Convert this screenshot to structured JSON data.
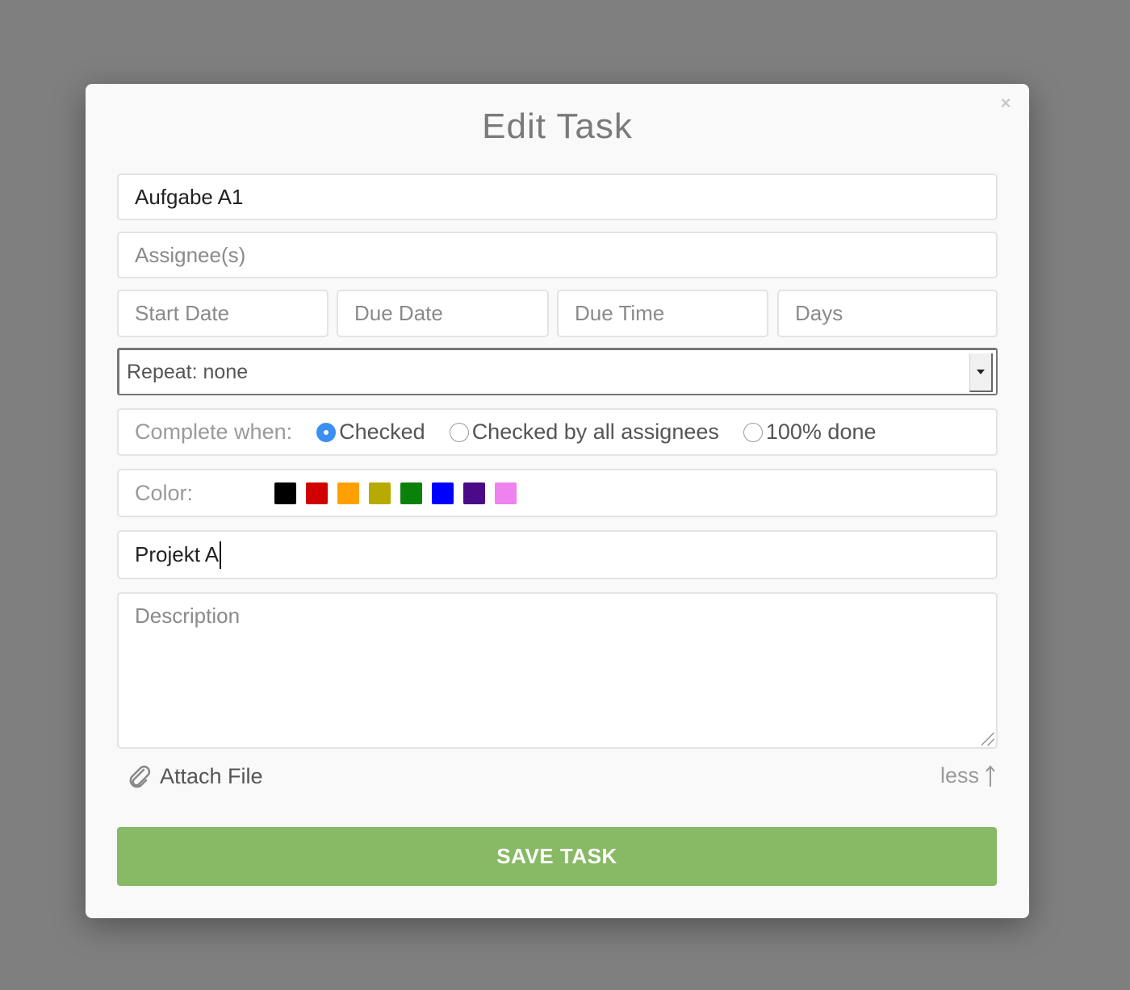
{
  "modal": {
    "title": "Edit Task",
    "close_icon": "×"
  },
  "fields": {
    "task_name": "Aufgabe A1",
    "assignees_placeholder": "Assignee(s)",
    "start_date_placeholder": "Start Date",
    "due_date_placeholder": "Due Date",
    "due_time_placeholder": "Due Time",
    "days_placeholder": "Days",
    "repeat_value": "Repeat: none",
    "project": "Projekt A",
    "description_placeholder": "Description"
  },
  "complete_when": {
    "label": "Complete when:",
    "options": [
      "Checked",
      "Checked by all assignees",
      "100% done"
    ],
    "selected": "Checked",
    "selected_color": "#3b8ff3"
  },
  "color": {
    "label": "Color:",
    "swatches": [
      "#000000",
      "#d00000",
      "#ffa000",
      "#b8aa00",
      "#0a820a",
      "#0000ff",
      "#4b0a88",
      "#ee82ee"
    ]
  },
  "attach": {
    "label": "Attach File",
    "icon": "paperclip-icon"
  },
  "less": {
    "label": "less",
    "icon": "arrow-up-icon"
  },
  "save_button": {
    "label": "SAVE TASK",
    "color": "#88b965"
  }
}
